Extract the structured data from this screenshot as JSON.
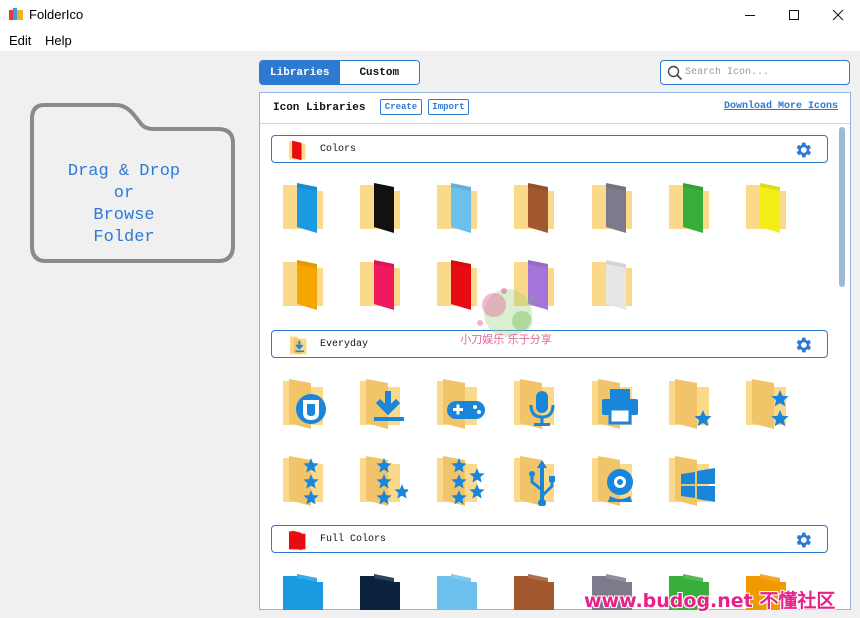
{
  "window": {
    "title": "FolderIco",
    "minimize_icon": "minimize-icon",
    "maximize_icon": "maximize-icon",
    "close_icon": "close-icon"
  },
  "menu": {
    "items": [
      "Edit",
      "Help"
    ]
  },
  "dropzone": {
    "line1": "Drag & Drop or",
    "line2": "Browse Folder"
  },
  "tabs": [
    {
      "label": "Libraries",
      "active": true
    },
    {
      "label": "Custom",
      "active": false
    }
  ],
  "search": {
    "placeholder": "Search Icon...",
    "value": ""
  },
  "panel": {
    "title": "Icon Libraries",
    "create_label": "Create",
    "import_label": "Import",
    "download_label": "Download More Icons"
  },
  "sections": [
    {
      "label": "Colors",
      "icon": "red-folder-icon",
      "folders": [
        {
          "name": "blue-folder-icon",
          "color": "#1a9ae0"
        },
        {
          "name": "black-folder-icon",
          "color": "#111111"
        },
        {
          "name": "light-blue-folder-icon",
          "color": "#6cc0ee"
        },
        {
          "name": "brown-folder-icon",
          "color": "#a0582c"
        },
        {
          "name": "grey-folder-icon",
          "color": "#7d7a8c"
        },
        {
          "name": "green-folder-icon",
          "color": "#3aae3a"
        },
        {
          "name": "yellow-folder-icon",
          "color": "#f4ee18"
        },
        {
          "name": "orange-folder-icon",
          "color": "#f6a500"
        },
        {
          "name": "pink-folder-icon",
          "color": "#f0195e"
        },
        {
          "name": "red-folder-icon",
          "color": "#e80c12"
        },
        {
          "name": "purple-folder-icon",
          "color": "#a474d8"
        },
        {
          "name": "white-folder-icon",
          "color": "#e6e6e6"
        }
      ]
    },
    {
      "label": "Everyday",
      "icon": "download-folder-icon",
      "folders": [
        {
          "name": "utorrent-folder-icon",
          "glyph": "torrent"
        },
        {
          "name": "download-folder-icon",
          "glyph": "download"
        },
        {
          "name": "gamepad-folder-icon",
          "glyph": "gamepad"
        },
        {
          "name": "microphone-folder-icon",
          "glyph": "mic"
        },
        {
          "name": "printer-folder-icon",
          "glyph": "printer"
        },
        {
          "name": "one-star-folder-icon",
          "glyph": "star1"
        },
        {
          "name": "two-star-folder-icon",
          "glyph": "star2"
        },
        {
          "name": "three-star-folder-icon",
          "glyph": "star3"
        },
        {
          "name": "four-star-folder-icon",
          "glyph": "star4"
        },
        {
          "name": "five-star-folder-icon",
          "glyph": "star5"
        },
        {
          "name": "usb-folder-icon",
          "glyph": "usb"
        },
        {
          "name": "webcam-folder-icon",
          "glyph": "webcam"
        },
        {
          "name": "windows-folder-icon",
          "glyph": "windows"
        }
      ]
    },
    {
      "label": "Full Colors",
      "icon": "full-red-folder-icon",
      "folders": [
        {
          "name": "full-blue-folder-icon",
          "color": "#1a9ae0"
        },
        {
          "name": "full-navy-folder-icon",
          "color": "#0c2340"
        },
        {
          "name": "full-light-blue-folder-icon",
          "color": "#6cc0ee"
        },
        {
          "name": "full-brown-folder-icon",
          "color": "#a0582c"
        },
        {
          "name": "full-grey-folder-icon",
          "color": "#7d7a8c"
        },
        {
          "name": "full-green-folder-icon",
          "color": "#3aae3a"
        },
        {
          "name": "full-orange-folder-icon",
          "color": "#f19a00"
        }
      ]
    }
  ],
  "watermark": {
    "text": "www.budog.net 不懂社区",
    "splash_text": "小刀娱乐 乐于分享"
  },
  "colors": {
    "accent": "#2f7ad1",
    "folder_base": "#fbd98a",
    "folder_shade": "#f1c46a"
  }
}
